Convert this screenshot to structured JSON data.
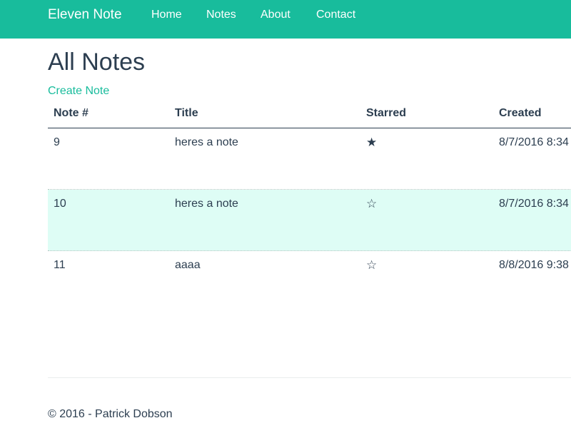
{
  "navbar": {
    "brand": "Eleven Note",
    "links": [
      "Home",
      "Notes",
      "About",
      "Contact"
    ],
    "background_color": "#18bc9c"
  },
  "main": {
    "title": "All Notes",
    "create_link": "Create Note",
    "table": {
      "columns": [
        "Note #",
        "Title",
        "Starred",
        "Created"
      ],
      "rows": [
        {
          "note_number": "9",
          "title": "heres a note",
          "starred": true,
          "star_glyph": "★",
          "created": "8/7/2016 8:34"
        },
        {
          "note_number": "10",
          "title": "heres a note",
          "starred": false,
          "star_glyph": "☆",
          "created": "8/7/2016 8:34"
        },
        {
          "note_number": "11",
          "title": "aaaa",
          "starred": false,
          "star_glyph": "☆",
          "created": "8/8/2016 9:38"
        }
      ]
    }
  },
  "footer": {
    "text": "© 2016 - Patrick Dobson"
  },
  "colors": {
    "accent": "#18bc9c",
    "text": "#2c3e50",
    "row_highlight": "#defdf5"
  }
}
